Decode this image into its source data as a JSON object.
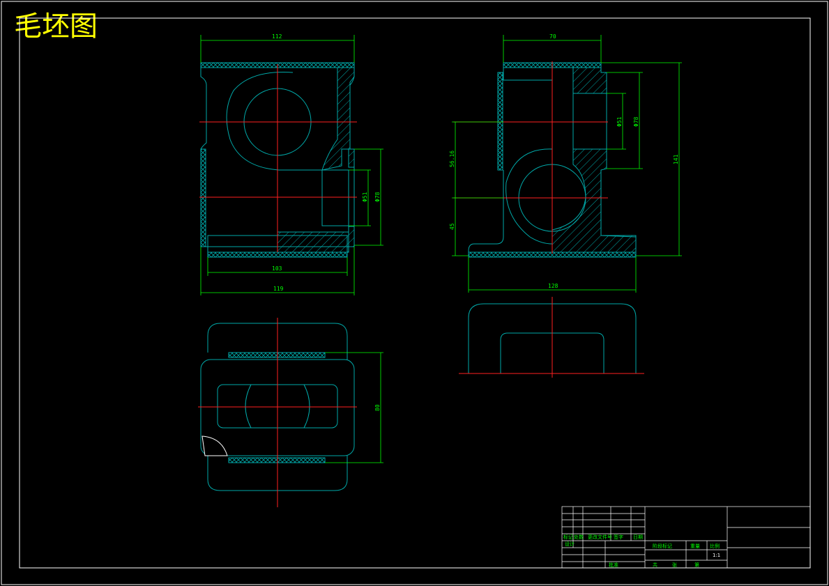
{
  "title": "毛坯图",
  "dimensions": {
    "front_top_width": "112",
    "front_bottom_inner": "103",
    "front_bottom_outer": "119",
    "front_bore_small": "Φ51",
    "front_bore_large": "Φ78",
    "side_top_width": "70",
    "side_bore_small": "Φ51",
    "side_bore_large": "Φ78",
    "side_height_total": "141",
    "side_height_upper": "56.16",
    "side_height_lower": "45",
    "side_base_width": "128",
    "top_view_height": "80"
  },
  "title_block": {
    "label_mark": "标记",
    "label_count": "处数",
    "label_doc": "更改文件号",
    "label_sign": "签字",
    "label_date": "日期",
    "label_design": "设计",
    "label_stage": "阶段标记",
    "label_weight": "重量",
    "label_scale": "比例",
    "scale_value": "1:1",
    "label_sheet": "共",
    "label_page": "张",
    "label_no": "第",
    "label_approve": "批准"
  },
  "colors": {
    "title": "#ffff00",
    "frame": "#ffffff",
    "object": "#00a8a8",
    "dimension": "#00ff00",
    "centerline": "#ff2020"
  }
}
